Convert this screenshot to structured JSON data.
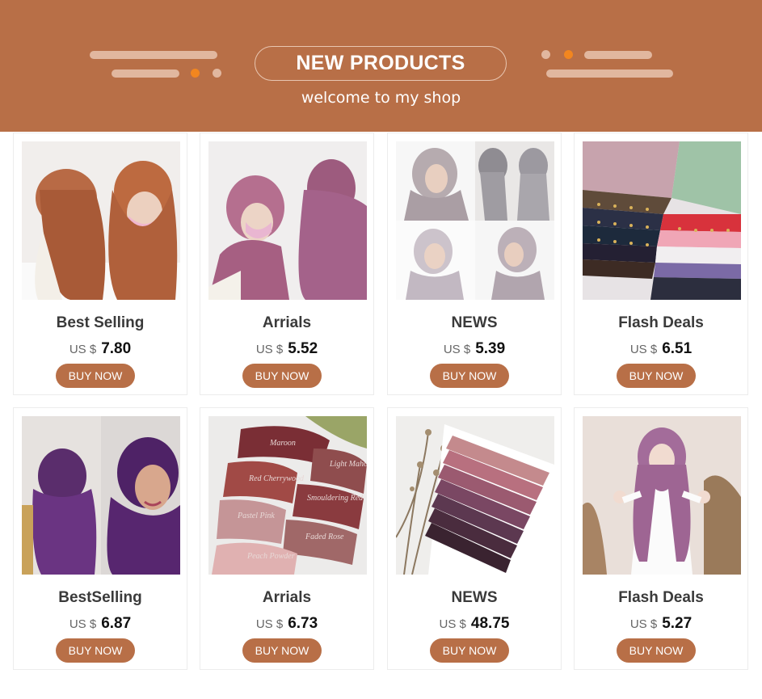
{
  "banner": {
    "title": "NEW PRODUCTS",
    "subtitle": "welcome to my shop"
  },
  "colors": {
    "brand": "#b86f47",
    "accent_dot": "#f2861f",
    "deco": "#e1b79f"
  },
  "products": [
    {
      "name": "Best Selling",
      "currency": "US $",
      "price": "7.80",
      "button": "BUY NOW",
      "image": "rust-hijab-two-models"
    },
    {
      "name": "Arrials",
      "currency": "US $",
      "price": "5.52",
      "button": "BUY NOW",
      "image": "mauve-hijab-two-models"
    },
    {
      "name": "NEWS",
      "currency": "US $",
      "price": "5.39",
      "button": "BUY NOW",
      "image": "grey-hijab-four-views"
    },
    {
      "name": "Flash Deals",
      "currency": "US $",
      "price": "6.51",
      "button": "BUY NOW",
      "image": "stacked-beaded-scarves"
    },
    {
      "name": "BestSelling",
      "currency": "US $",
      "price": "6.87",
      "button": "BUY NOW",
      "image": "purple-hijab-two-models"
    },
    {
      "name": "Arrials",
      "currency": "US $",
      "price": "6.73",
      "button": "BUY NOW",
      "image": "labelled-folded-scarves"
    },
    {
      "name": "NEWS",
      "currency": "US $",
      "price": "48.75",
      "button": "BUY NOW",
      "image": "boxed-scarf-set"
    },
    {
      "name": "Flash Deals",
      "currency": "US $",
      "price": "5.27",
      "button": "BUY NOW",
      "image": "mauve-hijab-full-body"
    }
  ],
  "scarf_labels": [
    "Maroon",
    "Light Mahogany",
    "Red Cherrywood",
    "Smouldering Red",
    "Pastel Pink",
    "Faded Rose",
    "Peach Powder"
  ]
}
